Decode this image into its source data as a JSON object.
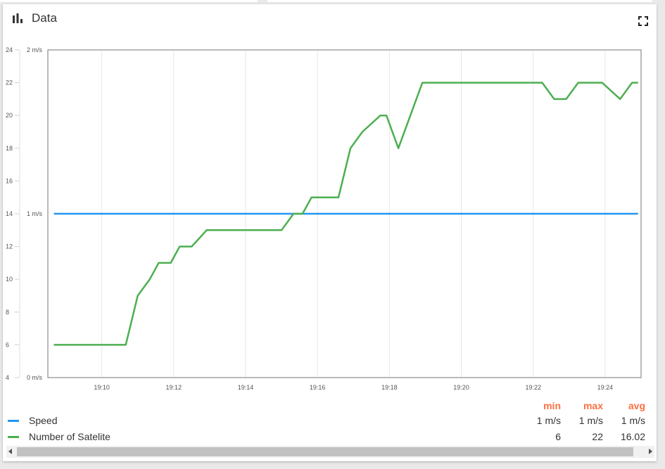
{
  "card": {
    "title": "Data"
  },
  "icons": {
    "title_icon": "bar-chart-icon",
    "fullscreen_icon": "fullscreen-icon"
  },
  "colors": {
    "speed": "#2196f3",
    "satellites": "#4caf50",
    "legend_header": "#ff6e42"
  },
  "legend": {
    "headers": {
      "min": "min",
      "max": "max",
      "avg": "avg"
    },
    "rows": [
      {
        "label": "Speed",
        "min": "1 m/s",
        "max": "1 m/s",
        "avg": "1 m/s"
      },
      {
        "label": "Number of Satelite",
        "min": "6",
        "max": "22",
        "avg": "16.02"
      }
    ]
  },
  "chart_data": {
    "type": "line",
    "x_range": [
      "19:08:30",
      "19:25:00"
    ],
    "x_ticks": [
      "19:10",
      "19:12",
      "19:14",
      "19:16",
      "19:18",
      "19:20",
      "19:22",
      "19:24"
    ],
    "y_left": {
      "ylim": [
        4,
        24
      ],
      "ticks": [
        "4",
        "6",
        "8",
        "10",
        "12",
        "14",
        "16",
        "18",
        "20",
        "22",
        "24"
      ]
    },
    "y_right": {
      "ylim": [
        0,
        2
      ],
      "ticks": [
        "0 m/s",
        "1 m/s",
        "2 m/s"
      ]
    },
    "grid": "vertical",
    "series": [
      {
        "name": "Speed",
        "axis": "right",
        "x": [
          "19:08:40",
          "19:24:55"
        ],
        "values": [
          1,
          1
        ]
      },
      {
        "name": "Number of Satelite",
        "axis": "left",
        "x": [
          "19:08:40",
          "19:10:40",
          "19:11:00",
          "19:11:20",
          "19:11:35",
          "19:11:55",
          "19:12:10",
          "19:12:30",
          "19:12:55",
          "19:15:00",
          "19:15:20",
          "19:15:35",
          "19:15:50",
          "19:16:35",
          "19:16:55",
          "19:17:15",
          "19:17:45",
          "19:17:55",
          "19:18:15",
          "19:18:55",
          "19:22:15",
          "19:22:35",
          "19:22:55",
          "19:23:15",
          "19:23:55",
          "19:24:25",
          "19:24:45",
          "19:24:55"
        ],
        "values": [
          6,
          6,
          9,
          10,
          11,
          11,
          12,
          12,
          13,
          13,
          14,
          14,
          15,
          15,
          18,
          19,
          20,
          20,
          18,
          22,
          22,
          21,
          21,
          22,
          22,
          21,
          22,
          22
        ]
      }
    ]
  }
}
